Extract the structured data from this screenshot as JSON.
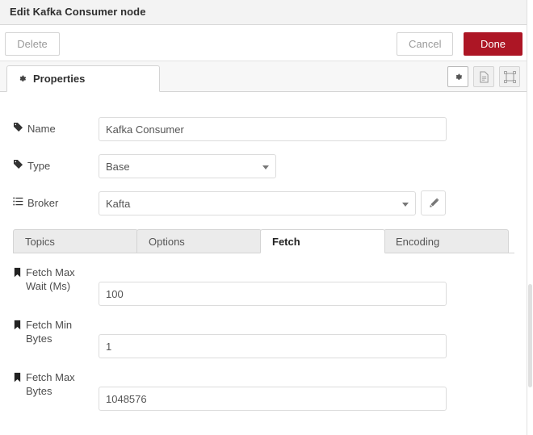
{
  "window": {
    "title": "Edit Kafka Consumer node"
  },
  "toolbar": {
    "delete_label": "Delete",
    "cancel_label": "Cancel",
    "done_label": "Done",
    "done_color": "#ad1625"
  },
  "panel_tabs": {
    "active": "Properties",
    "items": [
      {
        "label": "Properties",
        "icon": "gear-icon"
      }
    ],
    "icon_buttons": [
      {
        "name": "properties-gear-button",
        "icon": "gear-icon",
        "active": true
      },
      {
        "name": "description-button",
        "icon": "document-icon",
        "active": false
      },
      {
        "name": "appearance-button",
        "icon": "appearance-icon",
        "active": false
      }
    ]
  },
  "form": {
    "name": {
      "label": "Name",
      "icon": "tag-icon",
      "value": "Kafka Consumer",
      "placeholder": "Name"
    },
    "type": {
      "label": "Type",
      "icon": "tag-icon",
      "value": "Base",
      "options": [
        "Base"
      ]
    },
    "broker": {
      "label": "Broker",
      "icon": "list-icon",
      "value": "Kafta",
      "options": [
        "Kafta"
      ],
      "edit_icon": "pencil-icon"
    }
  },
  "subtabs": {
    "active": "Fetch",
    "items": [
      {
        "label": "Topics"
      },
      {
        "label": "Options"
      },
      {
        "label": "Fetch"
      },
      {
        "label": "Encoding"
      }
    ]
  },
  "fetch_fields": [
    {
      "label_line1": "Fetch Max",
      "label_line2": "Wait (Ms)",
      "icon": "bookmark-icon",
      "value": "100",
      "placeholder": ""
    },
    {
      "label_line1": "Fetch Min",
      "label_line2": "Bytes",
      "icon": "bookmark-icon",
      "value": "1",
      "placeholder": ""
    },
    {
      "label_line1": "Fetch Max",
      "label_line2": "Bytes",
      "icon": "bookmark-icon",
      "value": "1048576",
      "placeholder": ""
    }
  ]
}
